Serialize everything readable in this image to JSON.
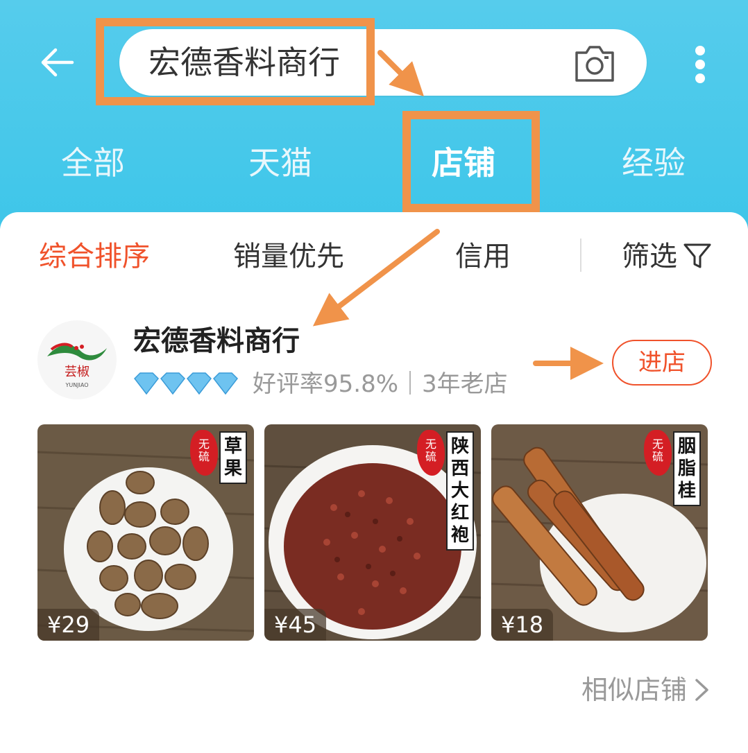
{
  "search": {
    "query": "宏德香料商行"
  },
  "tabs": [
    {
      "label": "全部"
    },
    {
      "label": "天猫"
    },
    {
      "label": "店铺"
    },
    {
      "label": "经验"
    }
  ],
  "sort_bar": {
    "comprehensive": "综合排序",
    "sales_first": "销量优先",
    "credit": "信用",
    "filter": "筛选"
  },
  "shop": {
    "name": "宏德香料商行",
    "logo_text": "芸椒",
    "logo_subtext": "YUNJIAO",
    "rating_text": "好评率95.8%｜3年老店",
    "enter_label": "进店"
  },
  "products": [
    {
      "label": "草果",
      "price": "¥29",
      "stamp": "无硫"
    },
    {
      "label": "陕西大红袍",
      "price": "¥45",
      "stamp": "无硫"
    },
    {
      "label": "胭脂桂",
      "price": "¥18",
      "stamp": "无硫"
    }
  ],
  "similar_shops": "相似店铺",
  "colors": {
    "header": "#45c7ea",
    "accent": "#f0522b",
    "annotation": "#f0934a"
  },
  "icons": [
    "back-arrow-icon",
    "camera-icon",
    "more-icon",
    "filter-icon",
    "diamond-icon",
    "chevron-right-icon"
  ]
}
